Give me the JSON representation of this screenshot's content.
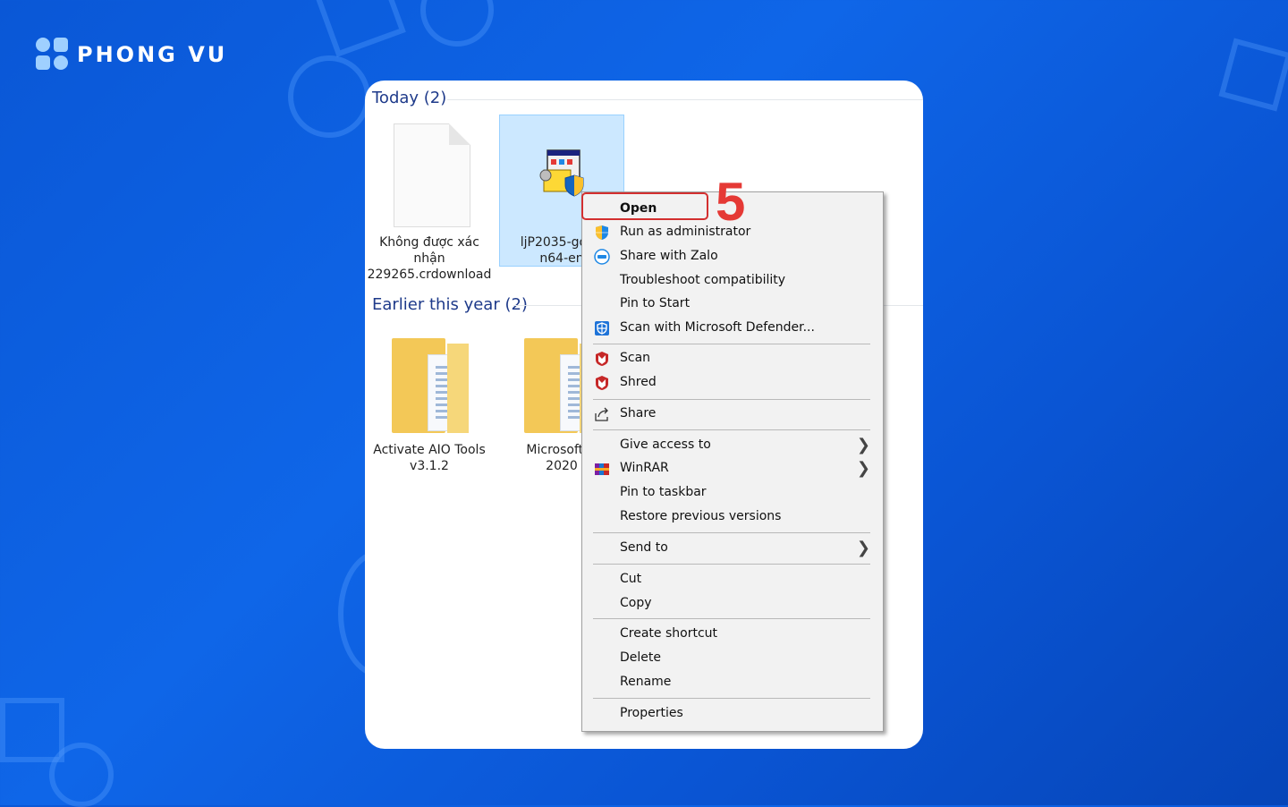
{
  "brand": {
    "name": "PHONG VU"
  },
  "explorer": {
    "groups": [
      {
        "label": "Today (2)"
      },
      {
        "label": "Earlier this year (2)"
      }
    ],
    "files": [
      {
        "name": "Không được xác nhận 229265.crdownload",
        "line1": "Không được xác",
        "line2": "nhận",
        "line3": "229265.crdownload",
        "type": "document"
      },
      {
        "name": "ljP2035-gdi-p n64-en",
        "line1": "ljP2035-gdi-p",
        "line2": "n64-en",
        "type": "installer",
        "selected": true
      },
      {
        "name": "Activate AIO Tools v3.1.2",
        "line1": "Activate AIO Tools",
        "line2": "v3.1.2",
        "type": "folder"
      },
      {
        "name": "Microsoft O 2020",
        "line1": "Microsoft O",
        "line2": "2020",
        "type": "folder"
      }
    ]
  },
  "context_menu": {
    "items": [
      {
        "label": "Open",
        "bold": true
      },
      {
        "label": "Run as administrator",
        "icon": "uac-shield-icon"
      },
      {
        "label": "Share with Zalo",
        "icon": "zalo-icon"
      },
      {
        "label": "Troubleshoot compatibility"
      },
      {
        "label": "Pin to Start"
      },
      {
        "label": "Scan with Microsoft Defender...",
        "icon": "defender-icon"
      },
      {
        "label": "Scan",
        "icon": "mcafee-icon"
      },
      {
        "label": "Shred",
        "icon": "mcafee-icon"
      },
      {
        "label": "Share",
        "icon": "share-icon"
      },
      {
        "label": "Give access to",
        "submenu": true
      },
      {
        "label": "WinRAR",
        "icon": "winrar-icon",
        "submenu": true
      },
      {
        "label": "Pin to taskbar"
      },
      {
        "label": "Restore previous versions"
      },
      {
        "label": "Send to",
        "submenu": true
      },
      {
        "label": "Cut"
      },
      {
        "label": "Copy"
      },
      {
        "label": "Create shortcut"
      },
      {
        "label": "Delete"
      },
      {
        "label": "Rename"
      },
      {
        "label": "Properties"
      }
    ]
  },
  "annotation": {
    "step": "5"
  },
  "colors": {
    "background": "#0a57d6",
    "highlight": "#d32f2f",
    "selection": "#cce8ff"
  }
}
